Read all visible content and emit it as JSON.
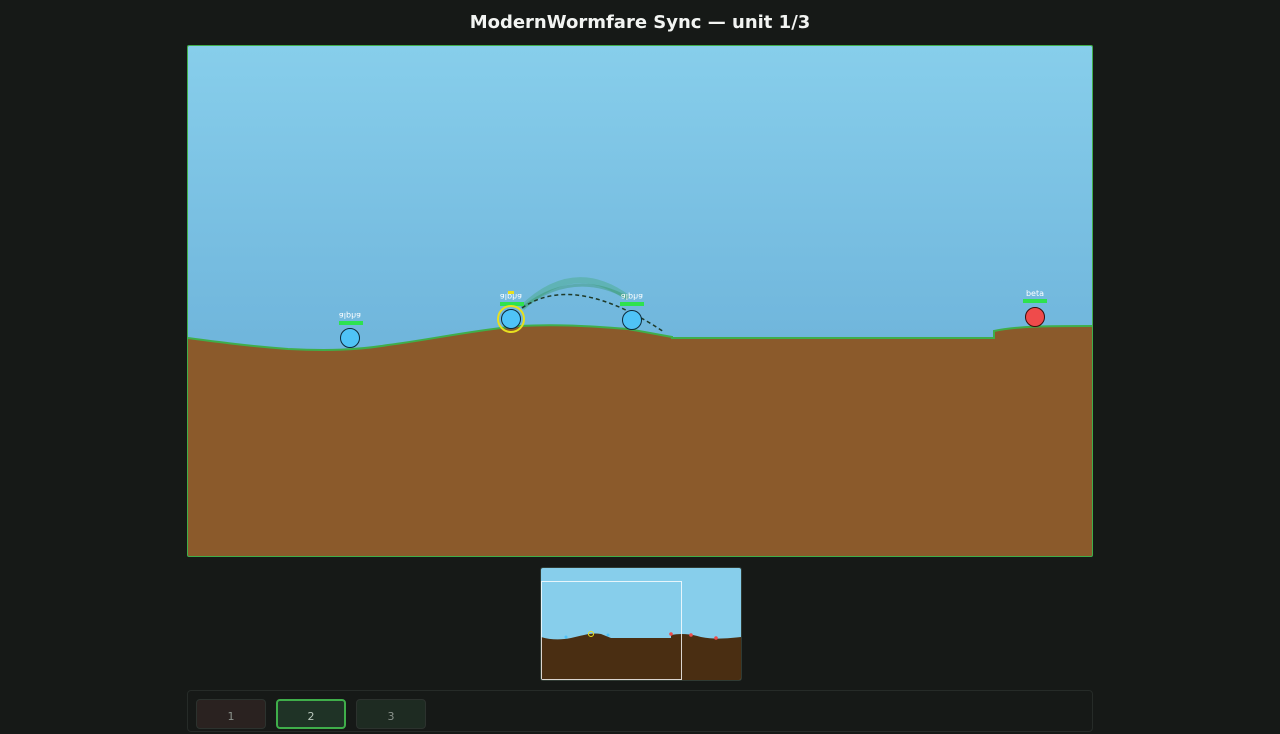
{
  "title": "ModernWormfare Sync — unit 1/3",
  "colors": {
    "sky_top": "#87CEEB",
    "sky_bottom": "#5FA4D1",
    "ground": "#8B5A2B",
    "grass": "#3FAE4A",
    "team_blue": "#4FC3F7",
    "team_red": "#EF4B4B",
    "health": "#2EE24F",
    "selection_ring": "#E8E01F"
  },
  "units": [
    {
      "name": "alpha",
      "team": "blue",
      "health": 1.0,
      "label_mirrored": true,
      "selected": false
    },
    {
      "name": "alpha",
      "team": "blue",
      "health": 1.0,
      "label_mirrored": true,
      "selected": true
    },
    {
      "name": "alpha",
      "team": "blue",
      "health": 1.0,
      "label_mirrored": true,
      "selected": false
    },
    {
      "name": "beta",
      "team": "red",
      "health": 1.0,
      "label_mirrored": false,
      "selected": false
    }
  ],
  "aim": {
    "visible": true,
    "style": "dashed-arc"
  },
  "minimap": {
    "visible": true
  },
  "tabs": [
    {
      "label": "1",
      "active": false
    },
    {
      "label": "2",
      "active": true
    },
    {
      "label": "3",
      "active": false
    }
  ]
}
